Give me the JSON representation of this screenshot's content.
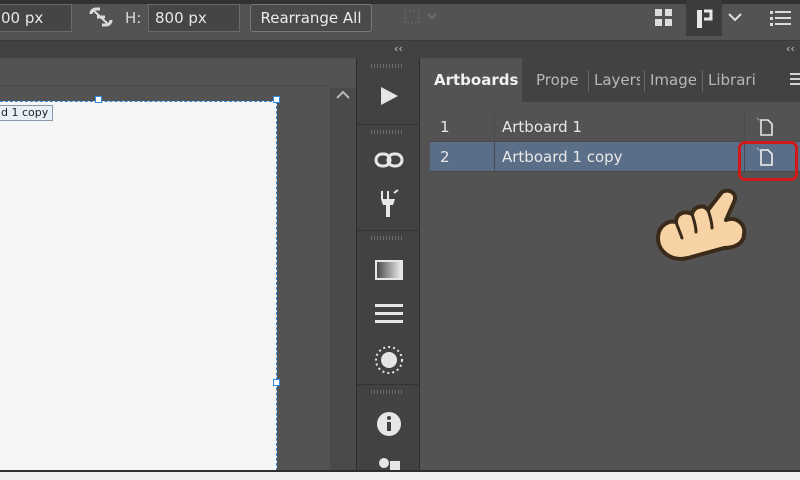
{
  "toolbar": {
    "width_value": "00 px",
    "height_label": "H:",
    "height_value": "800 px",
    "rearrange_label": "Rearrange All"
  },
  "panel_band": {
    "collapse_left": "‹‹",
    "collapse_right": "‹‹"
  },
  "canvas": {
    "artboard_label": "d 1 copy"
  },
  "tools": [
    "play-icon",
    "link-icon",
    "puppet-icon",
    "gradient-icon",
    "align-lines-icon",
    "sun-icon",
    "info-icon",
    "glyph-icon"
  ],
  "panel": {
    "tabs": [
      "Artboards",
      "Prope",
      "Layers",
      "Image",
      "Librari"
    ],
    "active_tab": "Artboards",
    "rows": [
      {
        "num": "1",
        "name": "Artboard 1"
      },
      {
        "num": "2",
        "name": "Artboard 1 copy"
      }
    ],
    "selected_row": 2
  },
  "colors": {
    "selection": "#5b6e87",
    "highlight": "#d01a1a",
    "artboard_border": "#2d8ae0"
  }
}
